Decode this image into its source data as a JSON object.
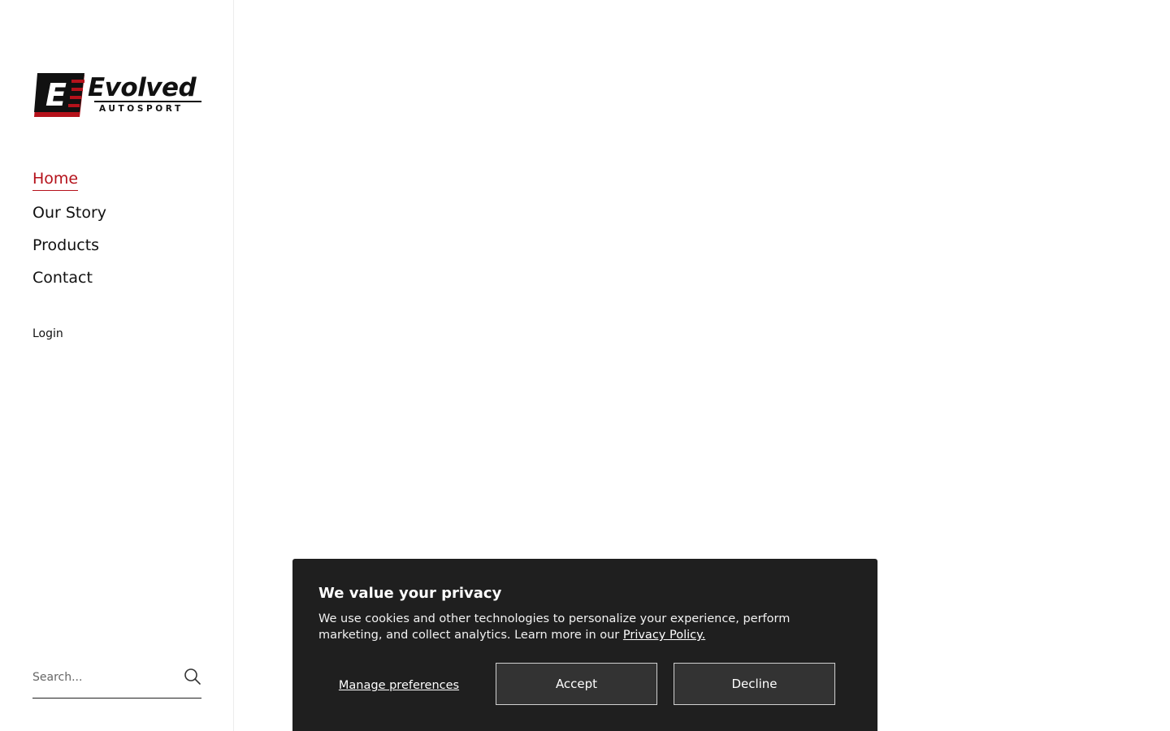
{
  "brand": {
    "name": "Evolved",
    "tagline": "AUTOSPORT",
    "mark_letter": "E",
    "colors": {
      "accent": "#b5121b",
      "text": "#111111",
      "banner_bg": "#1f1f1f",
      "button_bg": "#333333"
    }
  },
  "nav": {
    "items": [
      {
        "label": "Home",
        "active": true
      },
      {
        "label": "Our Story",
        "active": false
      },
      {
        "label": "Products",
        "active": false
      },
      {
        "label": "Contact",
        "active": false
      }
    ],
    "login_label": "Login"
  },
  "search": {
    "placeholder": "Search...",
    "value": "",
    "icon": "search-icon"
  },
  "consent": {
    "title": "We value your privacy",
    "body": "We use cookies and other technologies to personalize your experience, perform marketing, and collect analytics. Learn more in our ",
    "policy_link": "Privacy Policy.",
    "manage_label": "Manage preferences",
    "accept_label": "Accept",
    "decline_label": "Decline"
  }
}
